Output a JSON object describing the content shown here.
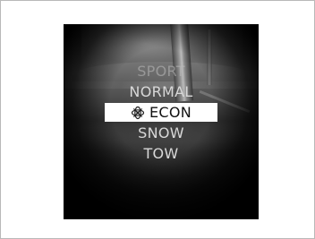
{
  "drive_mode_menu": {
    "items": [
      {
        "label": "SPORT",
        "state": "faded"
      },
      {
        "label": "NORMAL",
        "state": "normal"
      },
      {
        "label": "ECON",
        "state": "selected",
        "icon": "econ-leaf-icon"
      },
      {
        "label": "SNOW",
        "state": "normal"
      },
      {
        "label": "TOW",
        "state": "normal"
      }
    ]
  },
  "colors": {
    "highlight_bg": "#ffffff",
    "selected_text": "#111111",
    "menu_text": "#d8d8d8",
    "screen_bg": "#000000"
  }
}
